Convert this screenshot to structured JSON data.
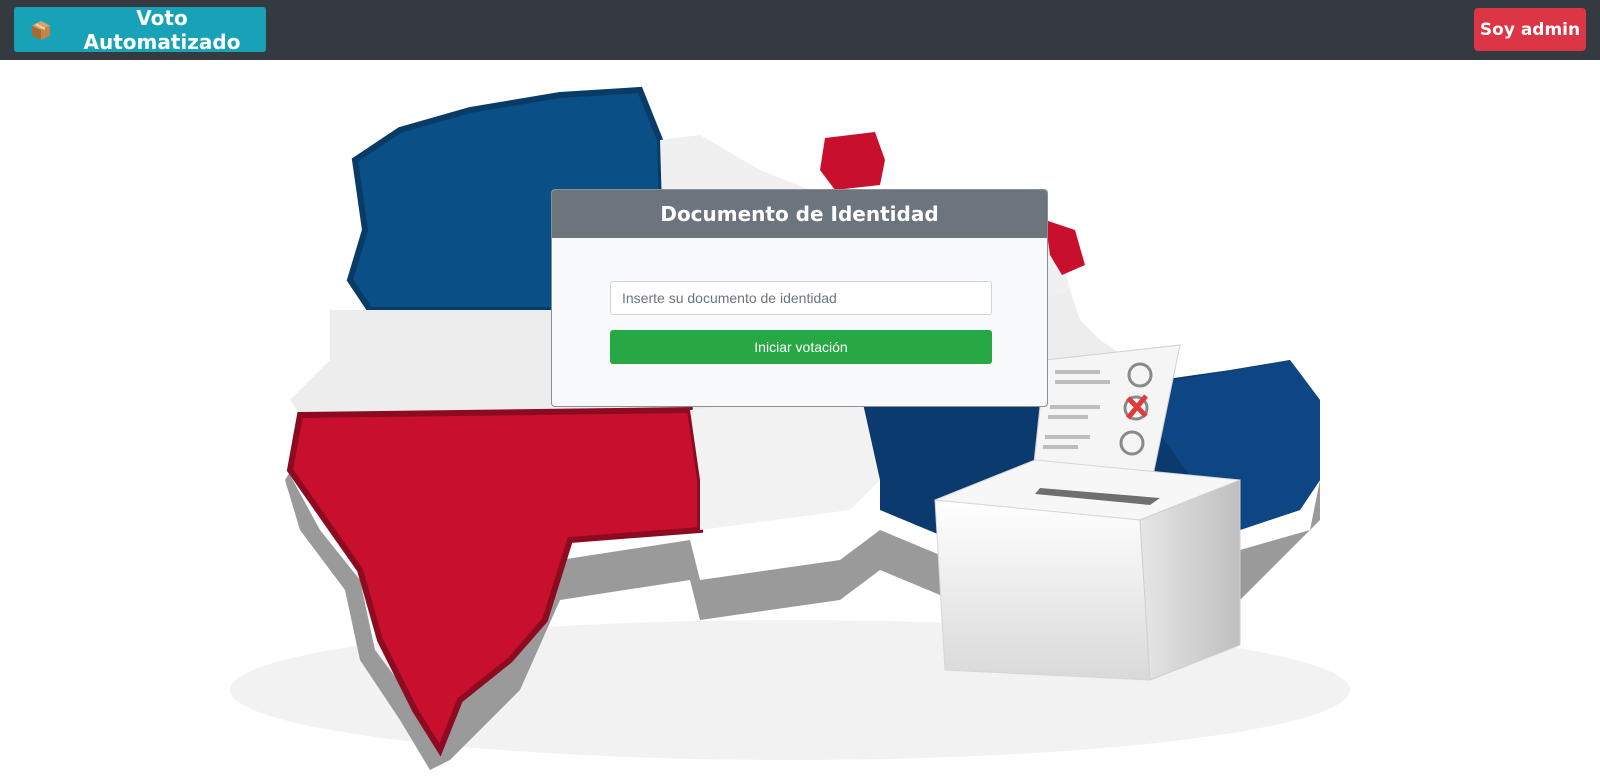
{
  "navbar": {
    "brand_label": "Voto Automatizado",
    "brand_icon": "package-icon",
    "admin_label": "Soy admin"
  },
  "login_card": {
    "title": "Documento de Identidad",
    "input_placeholder": "Inserte su documento de identidad",
    "input_value": "",
    "submit_label": "Iniciar votación"
  },
  "colors": {
    "navbar_bg": "#343a40",
    "brand_btn": "#17a2b8",
    "admin_btn": "#dc3545",
    "card_header": "#6c757d",
    "submit_btn": "#28a745",
    "flag_blue": "#0b4f87",
    "flag_red": "#c8102e"
  },
  "background_image": {
    "subject": "dominican-republic-flag-map-with-ballot-box"
  }
}
